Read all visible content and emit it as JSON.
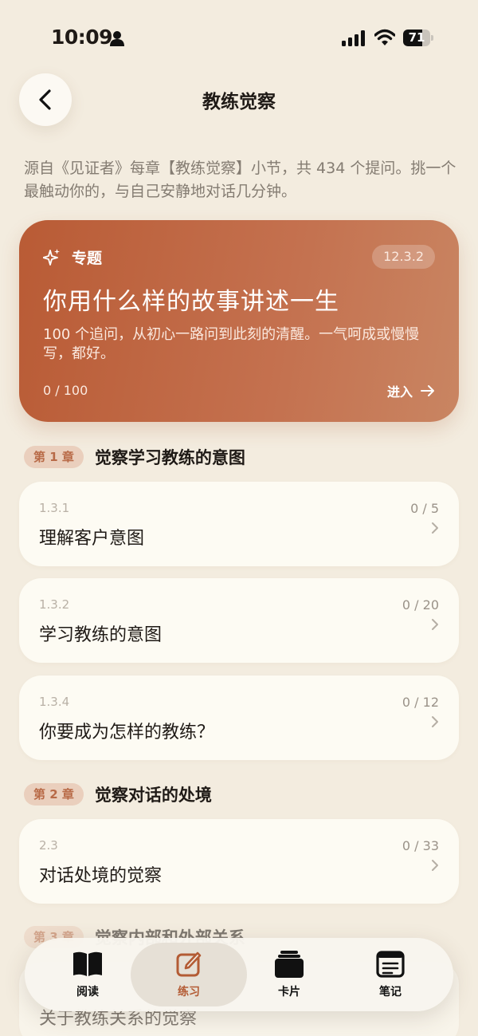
{
  "status_bar": {
    "time": "10:09",
    "battery_level": "71",
    "battery_fraction": 0.71
  },
  "nav": {
    "title": "教练觉察"
  },
  "intro": {
    "text": "源自《见证者》每章【教练觉察】小节，共 434 个提问。挑一个最触动你的，与自己安静地对话几分钟。"
  },
  "feature": {
    "tag": "专题",
    "badge": "12.3.2",
    "title": "你用什么样的故事讲述一生",
    "description": "100 个追问，从初心一路问到此刻的清醒。一气呵成或慢慢写，都好。",
    "progress": "0 / 100",
    "enter_label": "进入"
  },
  "chapters": [
    {
      "chip": "第 1 章",
      "title": "觉察学习教练的意图",
      "sections": [
        {
          "code": "1.3.1",
          "title": "理解客户意图",
          "count": "0 / 5"
        },
        {
          "code": "1.3.2",
          "title": "学习教练的意图",
          "count": "0 / 20"
        },
        {
          "code": "1.3.4",
          "title": "你要成为怎样的教练？",
          "count": "0 / 12"
        }
      ]
    },
    {
      "chip": "第 2 章",
      "title": "觉察对话的处境",
      "sections": [
        {
          "code": "2.3",
          "title": "对话处境的觉察",
          "count": "0 / 33"
        }
      ]
    },
    {
      "chip": "第 3 章",
      "title": "觉察内部和外部关系",
      "sections": [
        {
          "code": "",
          "title": "关于教练关系的觉察",
          "count": ""
        }
      ]
    }
  ],
  "tabbar": {
    "tabs": [
      {
        "label": "阅读",
        "icon": "book-icon"
      },
      {
        "label": "练习",
        "icon": "edit-icon",
        "active": true
      },
      {
        "label": "卡片",
        "icon": "cards-icon"
      },
      {
        "label": "笔记",
        "icon": "notes-icon"
      }
    ]
  }
}
